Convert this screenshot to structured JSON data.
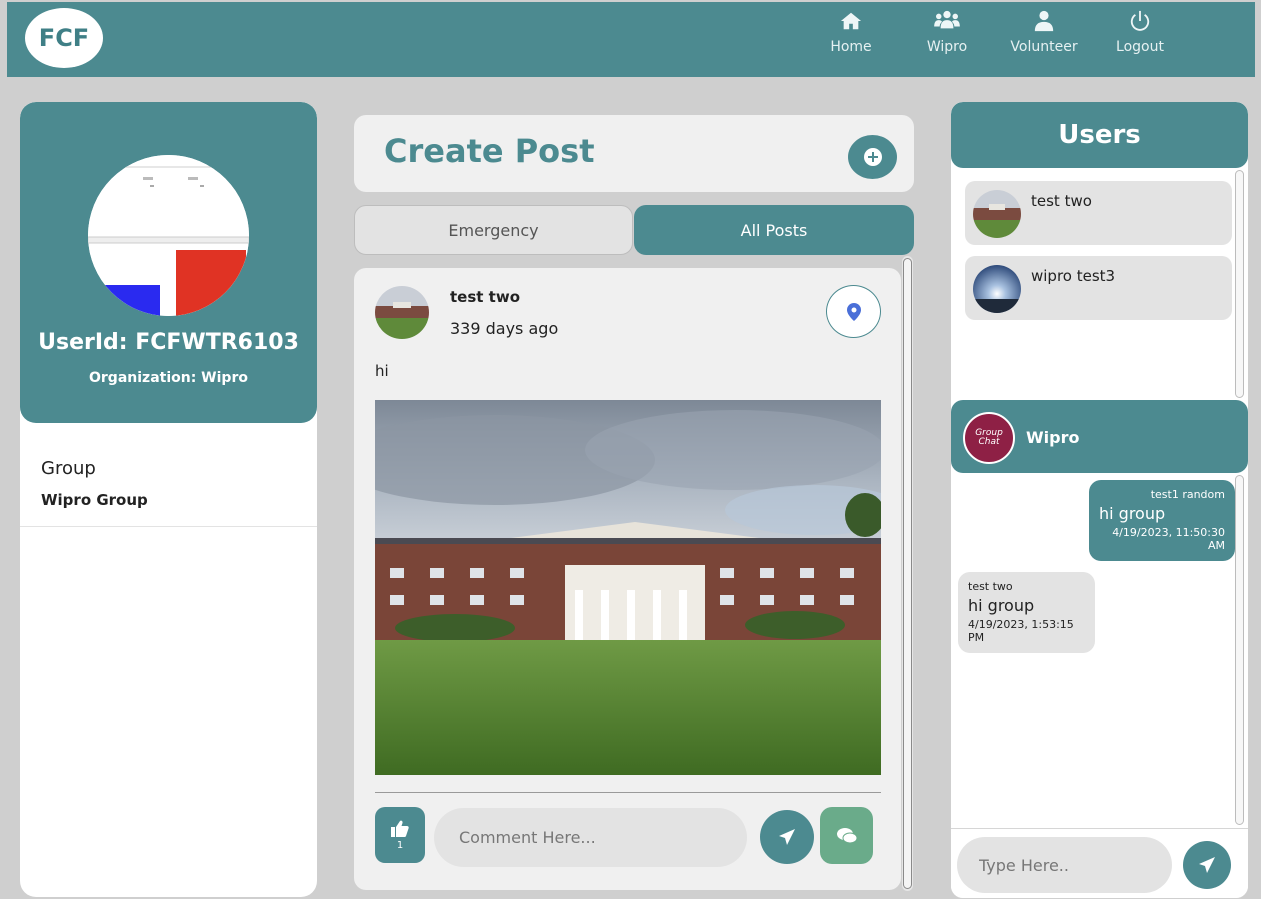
{
  "header": {
    "logo": "FCF",
    "nav": [
      {
        "label": "Home",
        "icon": "home-icon"
      },
      {
        "label": "Wipro",
        "icon": "users-icon"
      },
      {
        "label": "Volunteer",
        "icon": "user-icon"
      },
      {
        "label": "Logout",
        "icon": "power-icon"
      }
    ]
  },
  "profile": {
    "user_id": "UserId: FCFWTR6103",
    "organization": "Organization: Wipro",
    "group_title": "Group",
    "group_name": "Wipro Group"
  },
  "create_post": {
    "title": "Create Post",
    "tabs": [
      {
        "label": "Emergency",
        "active": false
      },
      {
        "label": "All Posts",
        "active": true
      }
    ]
  },
  "post": {
    "user": "test two",
    "time": "339 days ago",
    "text": "hi",
    "likes": "1",
    "comment_placeholder": "Comment Here..."
  },
  "users_panel": {
    "title": "Users",
    "users": [
      {
        "name": "test two"
      },
      {
        "name": "wipro test3"
      }
    ]
  },
  "group_chat": {
    "name": "Wipro",
    "logo_text": "Group Chat",
    "messages": [
      {
        "from": "test1 random",
        "text": "hi group",
        "time": "4/19/2023, 11:50:30 AM",
        "side": "right"
      },
      {
        "from": "test two",
        "text": "hi group",
        "time": "4/19/2023, 1:53:15 PM",
        "side": "left"
      }
    ],
    "input_placeholder": "Type Here.."
  },
  "colors": {
    "primary": "#4c8a90",
    "chat_button": "#6aab8a",
    "background": "#cfcfcf"
  }
}
